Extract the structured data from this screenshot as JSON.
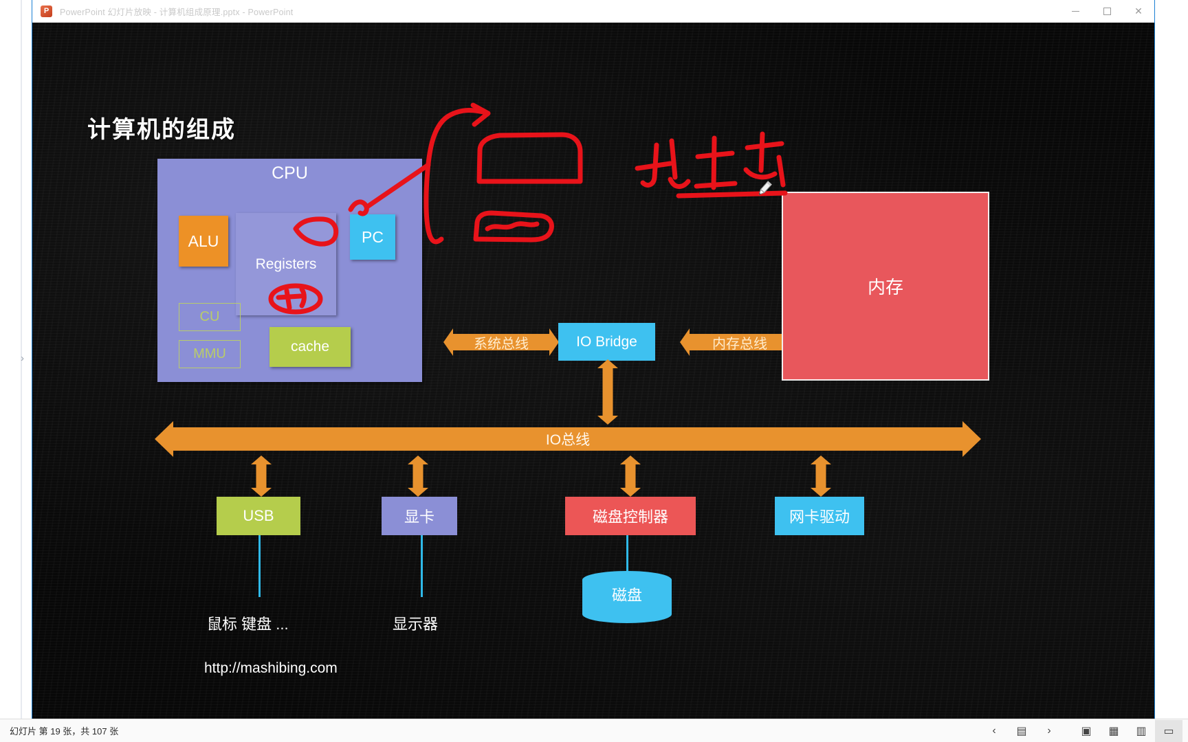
{
  "window": {
    "title": "PowerPoint 幻灯片放映  -  计算机组成原理.pptx - PowerPoint",
    "logo_letter": "P",
    "controls": {
      "minimize": "minimize-icon",
      "maximize": "maximize-icon",
      "close": "✕"
    }
  },
  "slide": {
    "title": "计算机的组成",
    "url": "http://mashibing.com",
    "cpu": {
      "label": "CPU",
      "alu": "ALU",
      "registers": "Registers",
      "pc": "PC",
      "cu": "CU",
      "mmu": "MMU",
      "cache": "cache"
    },
    "buses": {
      "system_bus": "系统总线",
      "memory_bus": "内存总线",
      "io_bus": "IO总线"
    },
    "io_bridge": "IO Bridge",
    "memory": "内存",
    "devices": [
      {
        "name": "usb",
        "label": "USB",
        "color": "#b5cd4c"
      },
      {
        "name": "gpu",
        "label": "显卡",
        "color": "#8b8fd6"
      },
      {
        "name": "diskctl",
        "label": "磁盘控制器",
        "color": "#ec5656"
      },
      {
        "name": "nic",
        "label": "网卡驱动",
        "color": "#3ec1f0"
      }
    ],
    "disk": "磁盘",
    "peripheral_labels": {
      "input": "鼠标 键盘 ...",
      "monitor": "显示器"
    },
    "ink_color": "#e8131a"
  },
  "status": {
    "text": "幻灯片 第 19 张，共 107 张",
    "buttons": [
      {
        "name": "previous-slide",
        "glyph": "‹"
      },
      {
        "name": "outline-view",
        "glyph": "▤"
      },
      {
        "name": "next-slide",
        "glyph": "›"
      },
      {
        "name": "normal-view",
        "glyph": "▣"
      },
      {
        "name": "slide-sorter-view",
        "glyph": "▦"
      },
      {
        "name": "reading-view",
        "glyph": "▥"
      },
      {
        "name": "slideshow-view",
        "glyph": "▭"
      }
    ]
  }
}
